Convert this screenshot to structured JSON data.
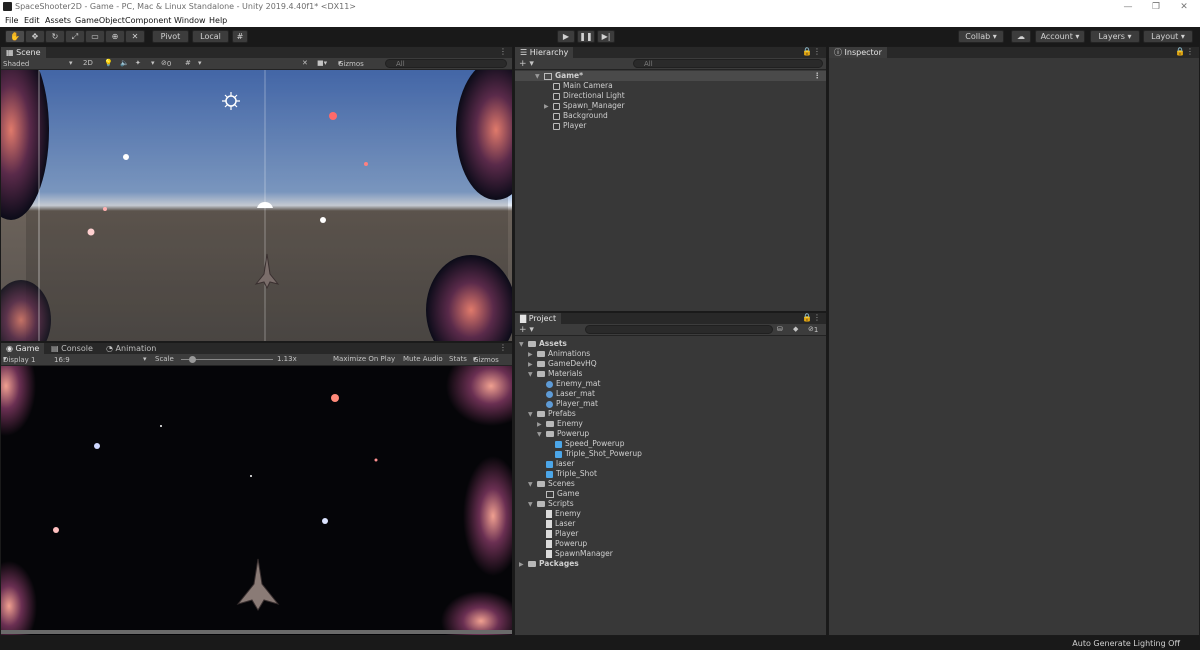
{
  "window": {
    "title": "SpaceShooter2D - Game - PC, Mac & Linux Standalone - Unity 2019.4.40f1* <DX11>"
  },
  "menu": [
    "File",
    "Edit",
    "Assets",
    "GameObject",
    "Component",
    "Window",
    "Help"
  ],
  "toolbar": {
    "pivot": "Pivot",
    "local": "Local",
    "collab": "Collab",
    "account": "Account",
    "layers": "Layers",
    "layout": "Layout"
  },
  "scene": {
    "tab": "Scene",
    "shading": "Shaded",
    "mode2d": "2D",
    "hidden_count": "0",
    "gizmos": "Gizmos",
    "search_placeholder": "All"
  },
  "game": {
    "tabs": [
      "Game",
      "Console",
      "Animation"
    ],
    "display": "Display 1",
    "aspect": "16:9",
    "scale_label": "Scale",
    "scale_value": "1.13x",
    "scale_level": 0.13,
    "maximize": "Maximize On Play",
    "mute": "Mute Audio",
    "stats": "Stats",
    "gizmos": "Gizmos"
  },
  "hierarchy": {
    "tab": "Hierarchy",
    "search_placeholder": "All",
    "scene_name": "Game*",
    "items": [
      "Main Camera",
      "Directional Light",
      "Spawn_Manager",
      "Background",
      "Player"
    ]
  },
  "project": {
    "tab": "Project",
    "hidden_count": "1",
    "tree": [
      {
        "label": "Assets",
        "kind": "folder-open",
        "depth": 0,
        "arrow": "open",
        "bold": true
      },
      {
        "label": "Animations",
        "kind": "folder",
        "depth": 1,
        "arrow": "closed"
      },
      {
        "label": "GameDevHQ",
        "kind": "folder",
        "depth": 1,
        "arrow": "closed"
      },
      {
        "label": "Materials",
        "kind": "folder-open",
        "depth": 1,
        "arrow": "open"
      },
      {
        "label": "Enemy_mat",
        "kind": "material",
        "depth": 2,
        "arrow": ""
      },
      {
        "label": "Laser_mat",
        "kind": "material",
        "depth": 2,
        "arrow": ""
      },
      {
        "label": "Player_mat",
        "kind": "material",
        "depth": 2,
        "arrow": ""
      },
      {
        "label": "Prefabs",
        "kind": "folder-open",
        "depth": 1,
        "arrow": "open"
      },
      {
        "label": "Enemy",
        "kind": "folder",
        "depth": 2,
        "arrow": "closed"
      },
      {
        "label": "Powerup",
        "kind": "folder-open",
        "depth": 2,
        "arrow": "open"
      },
      {
        "label": "Speed_Powerup",
        "kind": "prefab",
        "depth": 3,
        "arrow": ""
      },
      {
        "label": "Triple_Shot_Powerup",
        "kind": "prefab",
        "depth": 3,
        "arrow": ""
      },
      {
        "label": "laser",
        "kind": "prefab",
        "depth": 2,
        "arrow": ""
      },
      {
        "label": "Triple_Shot",
        "kind": "prefab",
        "depth": 2,
        "arrow": ""
      },
      {
        "label": "Scenes",
        "kind": "folder-open",
        "depth": 1,
        "arrow": "open"
      },
      {
        "label": "Game",
        "kind": "scene",
        "depth": 2,
        "arrow": ""
      },
      {
        "label": "Scripts",
        "kind": "folder-open",
        "depth": 1,
        "arrow": "open"
      },
      {
        "label": "Enemy",
        "kind": "script",
        "depth": 2,
        "arrow": ""
      },
      {
        "label": "Laser",
        "kind": "script",
        "depth": 2,
        "arrow": ""
      },
      {
        "label": "Player",
        "kind": "script",
        "depth": 2,
        "arrow": ""
      },
      {
        "label": "Powerup",
        "kind": "script",
        "depth": 2,
        "arrow": ""
      },
      {
        "label": "SpawnManager",
        "kind": "script",
        "depth": 2,
        "arrow": ""
      },
      {
        "label": "Packages",
        "kind": "folder",
        "depth": 0,
        "arrow": "closed",
        "bold": true
      }
    ]
  },
  "inspector": {
    "tab": "Inspector"
  },
  "status": {
    "text": "Auto Generate Lighting Off"
  }
}
